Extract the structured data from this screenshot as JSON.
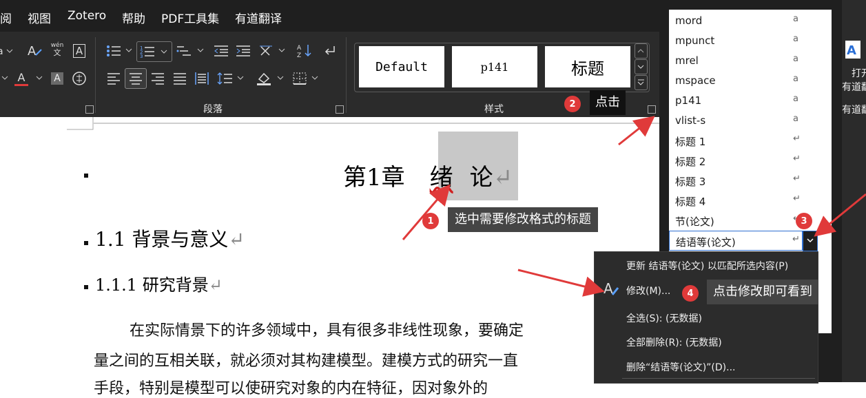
{
  "menubar": {
    "items": [
      "阅",
      "视图",
      "Zotero",
      "帮助",
      "PDF工具集",
      "有道翻译"
    ]
  },
  "ribbon": {
    "font_glyphs": {
      "font_color": "A",
      "shade": "A",
      "char_border": "A",
      "phonetic_top": "wén",
      "phonetic_bottom": "文"
    },
    "group_paragraph": "段落",
    "group_styles": "样式",
    "style_cards": [
      "Default",
      "p141",
      "标题"
    ],
    "youdao": {
      "line1": "打开",
      "line2": "有道翻",
      "group": "有道翻"
    }
  },
  "document": {
    "chapter_prefix": "第1章",
    "chapter_selected": "绪",
    "chapter_rest": "论",
    "heading1": "1.1 背景与意义",
    "heading2": "1.1.1 研究背景",
    "body_line1": "在实际情景下的许多领域中，具有很多非线性现象，要确定",
    "body_line2": "量之间的互相关联，就必须对其构建模型。建模方式的研究一直",
    "body_line3": "手段，特别是模型可以使研究对象的内在特征，因对象外的",
    "para_mark": "↵"
  },
  "style_pane": {
    "items": [
      {
        "name": "mord",
        "type": "a"
      },
      {
        "name": "mpunct",
        "type": "a"
      },
      {
        "name": "mrel",
        "type": "a"
      },
      {
        "name": "mspace",
        "type": "a"
      },
      {
        "name": "p141",
        "type": "a"
      },
      {
        "name": "vlist-s",
        "type": "a"
      },
      {
        "name": "标题 1",
        "type": "↵"
      },
      {
        "name": "标题 2",
        "type": "↵"
      },
      {
        "name": "标题 3",
        "type": "↵"
      },
      {
        "name": "标题 4",
        "type": "↵"
      },
      {
        "name": "节(论文)",
        "type": "↵"
      },
      {
        "name": "结语等(论文)",
        "type": "↵"
      }
    ]
  },
  "context_menu": {
    "update": "更新 结语等(论文) 以匹配所选内容(P)",
    "modify": "修改(M)...",
    "select_all": "全选(S): (无数据)",
    "delete_all": "全部删除(R): (无数据)",
    "delete": "删除“结语等(论文)”(D)..."
  },
  "annotations": [
    {
      "num": "1",
      "text": "选中需要修改格式的标题"
    },
    {
      "num": "2",
      "text": "点击"
    },
    {
      "num": "3",
      "text": ""
    },
    {
      "num": "4",
      "text": "点击修改即可看到"
    }
  ],
  "colors": {
    "accent_red": "#e03a3a",
    "selection": "#c8c8c8",
    "ribbon": "#2b2b2b",
    "menubar": "#1f1f1f"
  }
}
